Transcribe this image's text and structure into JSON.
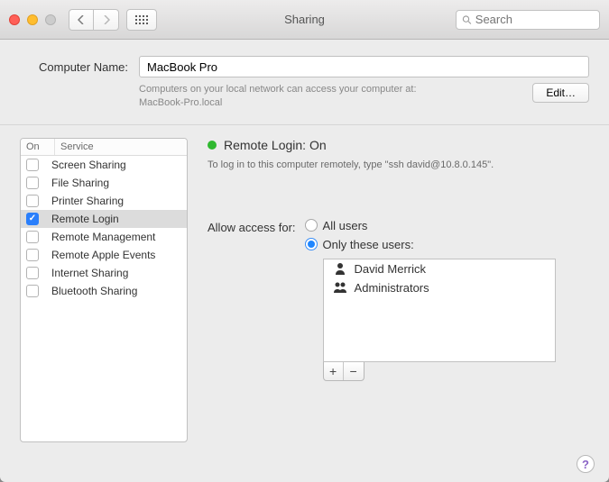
{
  "window": {
    "title": "Sharing"
  },
  "search": {
    "placeholder": "Search"
  },
  "computerName": {
    "label": "Computer Name:",
    "value": "MacBook Pro",
    "hint": "Computers on your local network can access your computer at:",
    "hostname": "MacBook-Pro.local",
    "editLabel": "Edit…"
  },
  "services": {
    "header_on": "On",
    "header_service": "Service",
    "items": [
      {
        "label": "Screen Sharing",
        "on": false,
        "selected": false
      },
      {
        "label": "File Sharing",
        "on": false,
        "selected": false
      },
      {
        "label": "Printer Sharing",
        "on": false,
        "selected": false
      },
      {
        "label": "Remote Login",
        "on": true,
        "selected": true
      },
      {
        "label": "Remote Management",
        "on": false,
        "selected": false
      },
      {
        "label": "Remote Apple Events",
        "on": false,
        "selected": false
      },
      {
        "label": "Internet Sharing",
        "on": false,
        "selected": false
      },
      {
        "label": "Bluetooth Sharing",
        "on": false,
        "selected": false
      }
    ]
  },
  "detail": {
    "status_label": "Remote Login: On",
    "status_color": "#2fb82f",
    "hint_prefix": "To log in to this computer remotely, type \"",
    "ssh_cmd": "ssh david@10.8.0.145",
    "hint_suffix": "\"."
  },
  "access": {
    "label": "Allow access for:",
    "options": [
      {
        "label": "All users",
        "selected": false
      },
      {
        "label": "Only these users:",
        "selected": true
      }
    ],
    "users": [
      {
        "name": "David Merrick",
        "kind": "user"
      },
      {
        "name": "Administrators",
        "kind": "group"
      }
    ],
    "add_label": "+",
    "remove_label": "−"
  },
  "help": {
    "label": "?"
  }
}
